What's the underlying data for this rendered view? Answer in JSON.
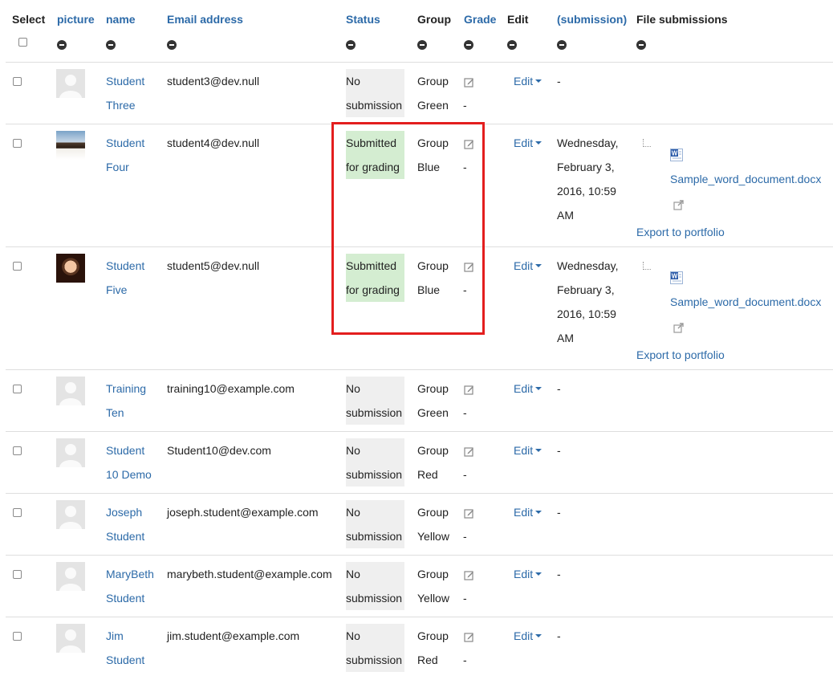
{
  "headers": {
    "select": "Select",
    "picture": "picture",
    "name": "name",
    "email": "Email address",
    "status": "Status",
    "group": "Group",
    "grade": "Grade",
    "edit": "Edit",
    "submission": "(submission)",
    "files": "File submissions"
  },
  "rows": [
    {
      "first": "Student",
      "last": "Three",
      "email": "student3@dev.null",
      "status_1": "No",
      "status_2": "submission",
      "group_1": "Group",
      "group_2": "Green",
      "grade": "-",
      "edit": "Edit",
      "submission": "-"
    },
    {
      "first": "Student",
      "last": "Four",
      "email": "student4@dev.null",
      "status_1": "Submitted",
      "status_2": "for grading",
      "group_1": "Group",
      "group_2": "Blue",
      "grade": "-",
      "edit": "Edit",
      "date_1": "Wednesday,",
      "date_2": "February 3,",
      "date_3": "2016, 10:59",
      "date_4": "AM",
      "file": "Sample_word_document.docx",
      "export": "Export to portfolio"
    },
    {
      "first": "Student",
      "last": "Five",
      "email": "student5@dev.null",
      "status_1": "Submitted",
      "status_2": "for grading",
      "group_1": "Group",
      "group_2": "Blue",
      "grade": "-",
      "edit": "Edit",
      "date_1": "Wednesday,",
      "date_2": "February 3,",
      "date_3": "2016, 10:59",
      "date_4": "AM",
      "file": "Sample_word_document.docx",
      "export": "Export to portfolio"
    },
    {
      "first": "Training",
      "last": "Ten",
      "email": "training10@example.com",
      "status_1": "No",
      "status_2": "submission",
      "group_1": "Group",
      "group_2": "Green",
      "grade": "-",
      "edit": "Edit",
      "submission": "-"
    },
    {
      "first": "Student",
      "last": "10 Demo",
      "email": "Student10@dev.com",
      "status_1": "No",
      "status_2": "submission",
      "group_1": "Group",
      "group_2": "Red",
      "grade": "-",
      "edit": "Edit",
      "submission": "-"
    },
    {
      "first": "Joseph",
      "last": "Student",
      "email": "joseph.student@example.com",
      "status_1": "No",
      "status_2": "submission",
      "group_1": "Group",
      "group_2": "Yellow",
      "grade": "-",
      "edit": "Edit",
      "submission": "-"
    },
    {
      "first": "MaryBeth",
      "last": "Student",
      "email": "marybeth.student@example.com",
      "status_1": "No",
      "status_2": "submission",
      "group_1": "Group",
      "group_2": "Yellow",
      "grade": "-",
      "edit": "Edit",
      "submission": "-"
    },
    {
      "first": "Jim",
      "last": "Student",
      "email": "jim.student@example.com",
      "status_1": "No",
      "status_2": "submission",
      "group_1": "Group",
      "group_2": "Red",
      "grade": "-",
      "edit": "Edit",
      "submission": "-"
    }
  ],
  "icons": {
    "collapse": "minus-circle-icon",
    "grade": "pencil-edit-icon",
    "file": "word-document-icon",
    "portfolio": "export-portfolio-icon",
    "avatar_default": "default-user-avatar",
    "avatar_photo": "user-photo-avatar"
  },
  "colors": {
    "link": "#2c6aa8",
    "status_no_submission": "#efefef",
    "status_submitted": "#d4edd1",
    "highlight": "#e31e1e",
    "row_border": "#dedede"
  }
}
